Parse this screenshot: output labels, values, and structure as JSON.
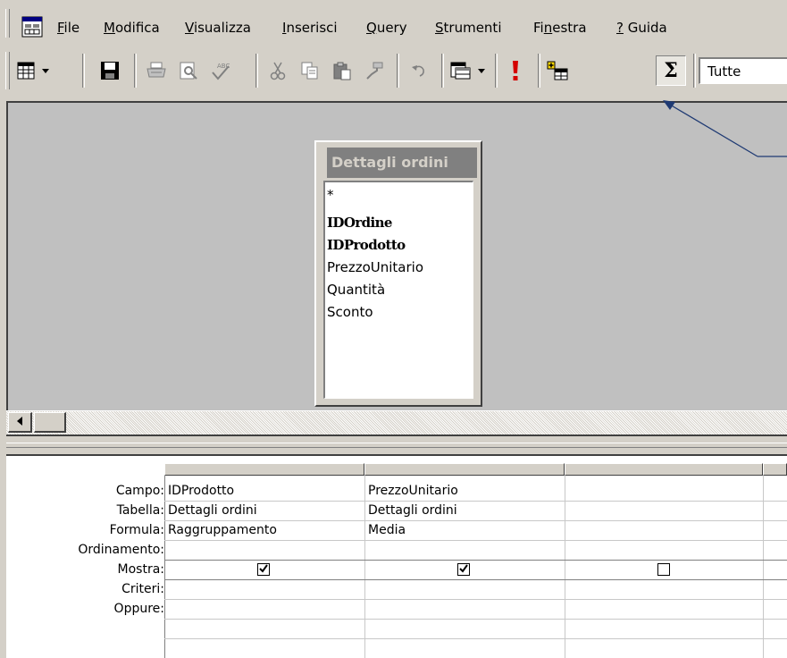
{
  "menu": {
    "items": [
      {
        "pre": "",
        "key": "F",
        "post": "ile"
      },
      {
        "pre": "",
        "key": "M",
        "post": "odifica"
      },
      {
        "pre": "",
        "key": "V",
        "post": "isualizza"
      },
      {
        "pre": "",
        "key": "I",
        "post": "nserisci"
      },
      {
        "pre": "",
        "key": "Q",
        "post": "uery"
      },
      {
        "pre": "",
        "key": "S",
        "post": "trumenti"
      },
      {
        "pre": "Fi",
        "key": "n",
        "post": "estra"
      },
      {
        "pre": "",
        "key": "?",
        "post": " Guida"
      }
    ]
  },
  "toolbar": {
    "sigma_label": "Σ",
    "combo_value": "Tutte",
    "icons": [
      "view-icon",
      "save-icon",
      "print-icon",
      "print-preview-icon",
      "spelling-icon",
      "cut-icon",
      "copy-icon",
      "paste-icon",
      "format-painter-icon",
      "undo-icon",
      "query-type-icon",
      "run-icon",
      "show-table-icon",
      "totals-icon"
    ]
  },
  "field_list": {
    "title": "Dettagli ordini",
    "fields": [
      {
        "name": "*",
        "key": false
      },
      {
        "name": "IDOrdine",
        "key": true
      },
      {
        "name": "IDProdotto",
        "key": true
      },
      {
        "name": "PrezzoUnitario",
        "key": false
      },
      {
        "name": "Quantità",
        "key": false
      },
      {
        "name": "Sconto",
        "key": false
      }
    ]
  },
  "grid": {
    "row_labels": {
      "campo": "Campo:",
      "tabella": "Tabella:",
      "formula": "Formula:",
      "ordinamento": "Ordinamento:",
      "mostra": "Mostra:",
      "criteri": "Criteri:",
      "oppure": "Oppure:"
    },
    "columns": [
      {
        "campo": "IDProdotto",
        "tabella": "Dettagli ordini",
        "formula": "Raggruppamento",
        "ordinamento": "",
        "mostra": true
      },
      {
        "campo": "PrezzoUnitario",
        "tabella": "Dettagli ordini",
        "formula": "Media",
        "ordinamento": "",
        "mostra": true
      },
      {
        "campo": "",
        "tabella": "",
        "formula": "",
        "ordinamento": "",
        "mostra": false
      }
    ]
  },
  "colors": {
    "background": "#e4edfa",
    "chrome": "#d4d0c8",
    "design_area": "#c0c0c0",
    "arrow": "#1f3a73",
    "run_icon": "#d40000"
  }
}
